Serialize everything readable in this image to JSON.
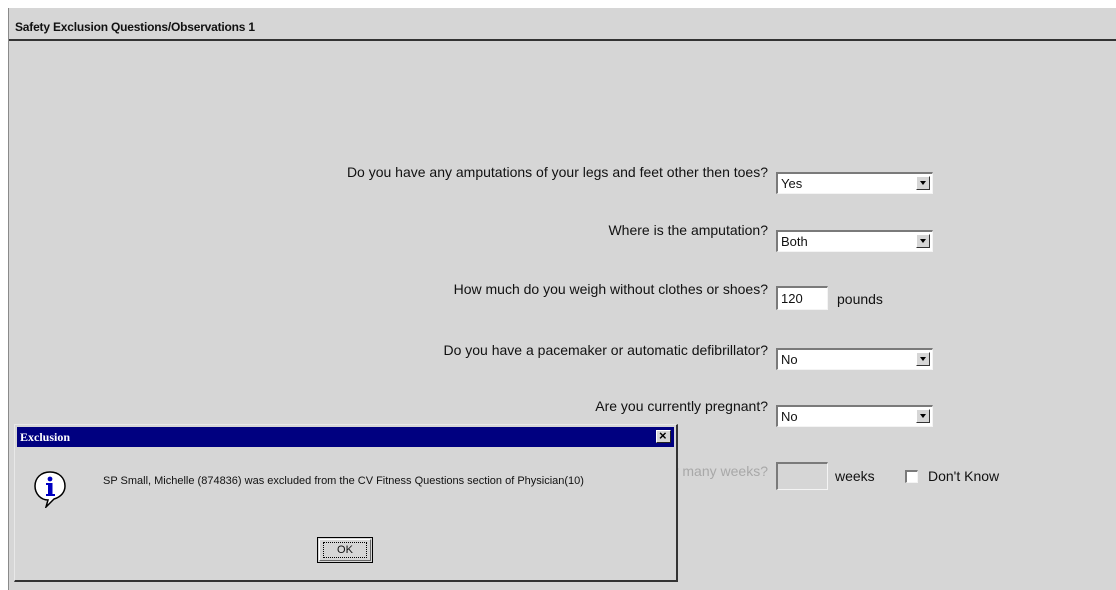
{
  "section": {
    "title": "Safety Exclusion Questions/Observations 1"
  },
  "questions": {
    "amputation": {
      "label": "Do you have any amputations of your legs and feet other then toes?",
      "value": "Yes"
    },
    "location": {
      "label": "Where is the amputation?",
      "value": "Both"
    },
    "weight": {
      "label": "How much do you weigh without clothes or shoes?",
      "value": "120",
      "unit": "pounds"
    },
    "pacemaker": {
      "label": "Do you have a pacemaker or automatic defibrillator?",
      "value": "No"
    },
    "pregnant": {
      "label": "Are you currently pregnant?",
      "value": "No"
    },
    "weeks": {
      "label": "How many weeks?",
      "value": "",
      "unit": "weeks",
      "dont_know": "Don't Know"
    }
  },
  "dialog": {
    "title": "Exclusion",
    "close": "×",
    "message": "SP Small, Michelle  (874836) was excluded from the CV Fitness Questions section of Physician(10)",
    "ok": "OK",
    "icon": "info-icon"
  }
}
